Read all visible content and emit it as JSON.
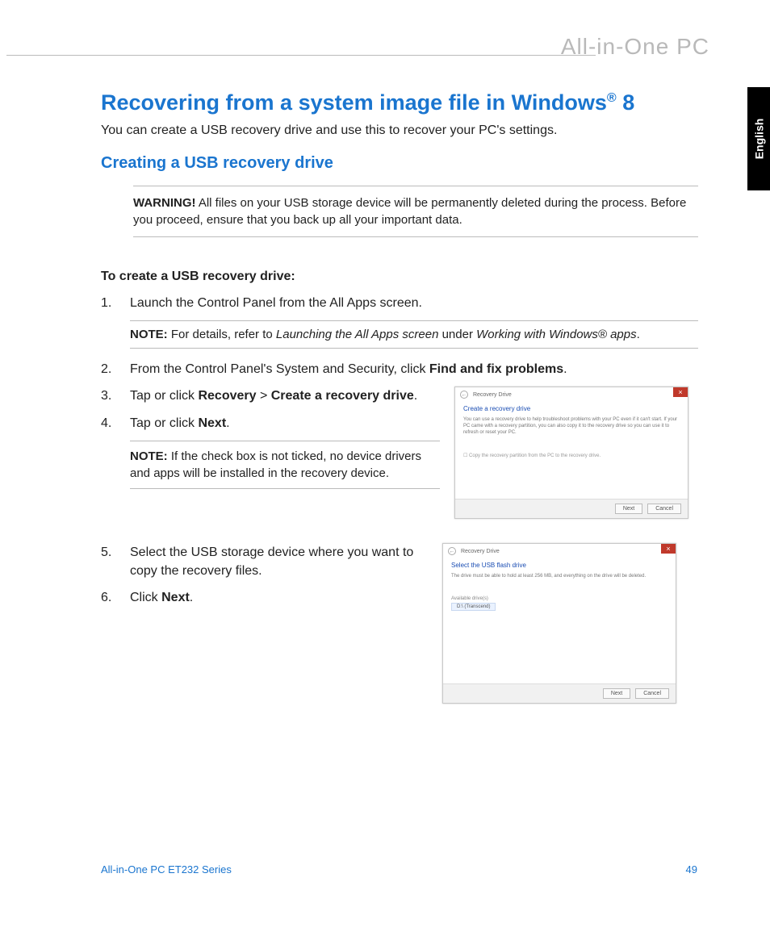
{
  "brand": "All-in-One PC",
  "langTab": "English",
  "title_pre": "Recovering from a system image file in Windows",
  "title_reg": "®",
  "title_suf": " 8",
  "intro": "You can create a USB recovery drive and use this to recover your PC's settings.",
  "h2": "Creating a USB recovery drive",
  "warning_label": "WARNING!",
  "warning_text": "  All files on your USB storage device will be permanently deleted during the process. Before you proceed, ensure that you back up all your important data.",
  "section_head": "To create a USB recovery drive:",
  "step1": "Launch the Control Panel from the All Apps screen.",
  "note1_label": "NOTE:",
  "note1_pre": "    For details, refer to ",
  "note1_i1": "Launching the All Apps screen",
  "note1_mid": " under ",
  "note1_i2": "Working with Windows® apps",
  "note1_end": ".",
  "step2_pre": "From the Control Panel's System and Security, click ",
  "step2_b": "Find and fix problems",
  "step2_end": ".",
  "step3_pre": "Tap or click ",
  "step3_b1": "Recovery",
  "step3_mid": " > ",
  "step3_b2": "Create a recovery drive",
  "step3_end": ".",
  "step4_pre": "Tap or click ",
  "step4_b": "Next",
  "step4_end": ".",
  "note2_label": "NOTE:",
  "note2_text": "    If the check box is not ticked, no device drivers and apps will be installed in the recovery device.",
  "step5": "Select the USB storage device where you want to copy the recovery files.",
  "step6_pre": "Click ",
  "step6_b": "Next",
  "step6_end": ".",
  "dialog1": {
    "title": "Recovery Drive",
    "heading": "Create a recovery drive",
    "desc": "You can use a recovery drive to help troubleshoot problems with your PC even if it can't start. If your PC came with a recovery partition, you can also copy it to the recovery drive so you can use it to refresh or reset your PC.",
    "chk": "Copy the recovery partition from the PC to the recovery drive.",
    "btn1": "Next",
    "btn2": "Cancel"
  },
  "dialog2": {
    "title": "Recovery Drive",
    "heading": "Select the USB flash drive",
    "desc": "The drive must be able to hold at least 256 MB, and everything on the drive will be deleted.",
    "avail_label": "Available drive(s)",
    "avail_item": "D:\\ (Transcend)",
    "btn1": "Next",
    "btn2": "Cancel"
  },
  "footer_left": "All-in-One PC ET232 Series",
  "footer_right": "49"
}
